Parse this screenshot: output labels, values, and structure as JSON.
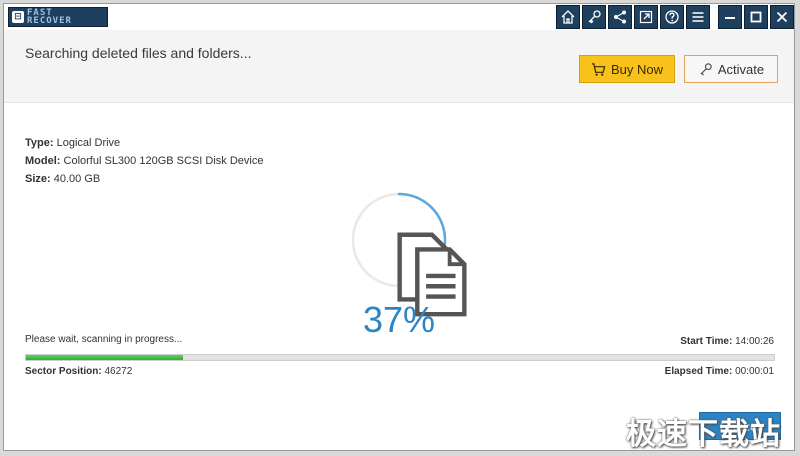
{
  "app": {
    "logo_icon": "disk-recovery-logo-icon",
    "logo_line1": "FAST",
    "logo_line2": "RECOVER"
  },
  "titlebar": {
    "tools": [
      "home-icon",
      "key-icon",
      "share-icon",
      "export-icon",
      "help-icon",
      "menu-icon"
    ],
    "window_controls": [
      "minimize-icon",
      "maximize-icon",
      "close-icon"
    ]
  },
  "header": {
    "status": "Searching deleted files and folders...",
    "buy_label": "Buy Now",
    "activate_label": "Activate"
  },
  "drive": {
    "type_label": "Type:",
    "type_value": "Logical Drive",
    "model_label": "Model:",
    "model_value": "Colorful SL300 120GB SCSI Disk Device",
    "size_label": "Size:",
    "size_value": "40.00 GB"
  },
  "scan": {
    "percent_text": "37%",
    "progress_fraction": 0.21,
    "wait_text": "Please wait, scanning in progress...",
    "start_label": "Start Time:",
    "start_value": "14:00:26",
    "sector_label": "Sector Position:",
    "sector_value": "46272",
    "elapsed_label": "Elapsed Time:",
    "elapsed_value": "00:00:01"
  },
  "footer": {
    "cancel_label": "Cancel",
    "watermark": "极速下载站"
  },
  "colors": {
    "accent": "#2d84c4",
    "buy": "#f7c21c",
    "progress": "#2eae2e",
    "titlebar_tool": "#1f3f5e"
  }
}
